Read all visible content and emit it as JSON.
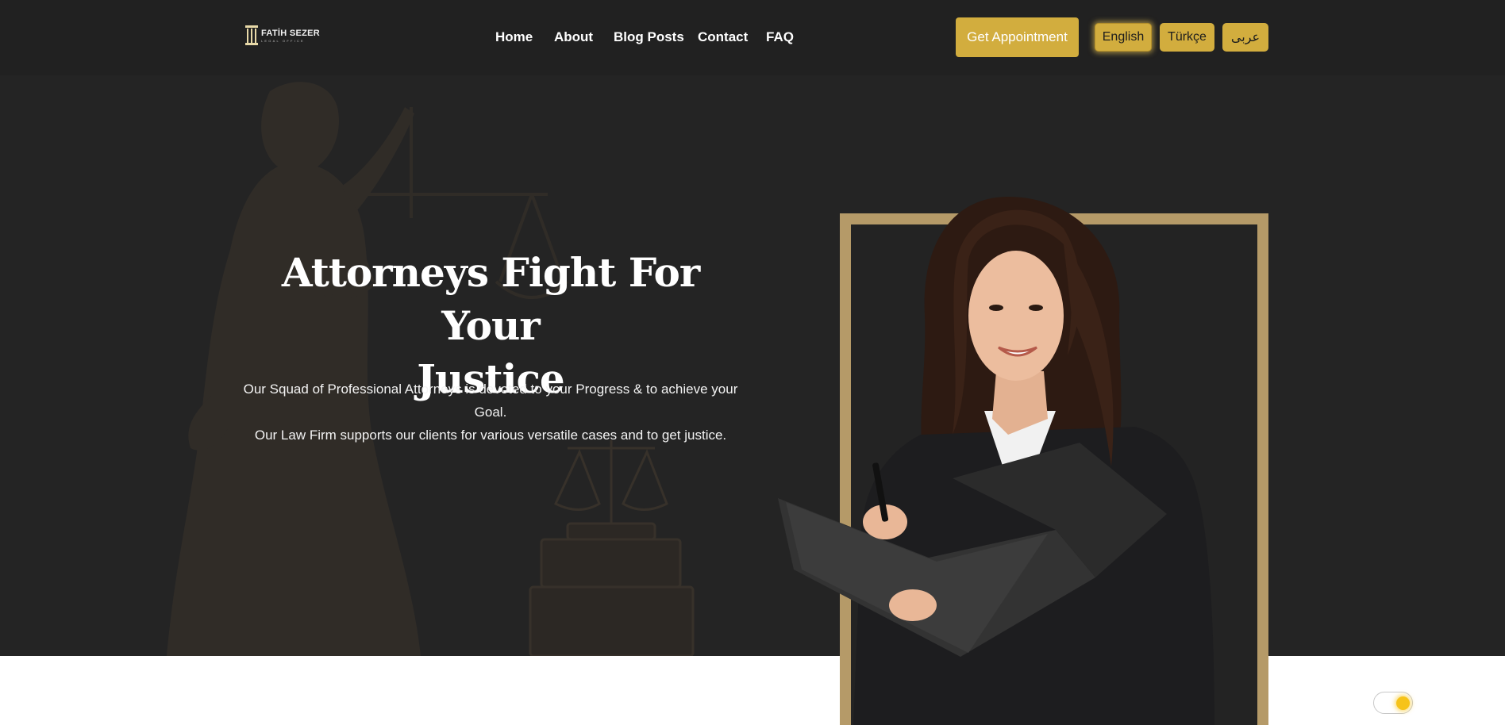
{
  "brand": {
    "name": "FATİH SEZER",
    "subtitle": "LEGAL OFFICE",
    "accent_color": "#d2ad3e",
    "frame_color": "#b59a68",
    "header_bg": "#212121",
    "hero_bg": "#242424"
  },
  "nav": {
    "items": [
      {
        "label": "Home"
      },
      {
        "label": "About"
      },
      {
        "label": "Blog Posts"
      },
      {
        "label": "Contact"
      },
      {
        "label": "FAQ"
      }
    ]
  },
  "header": {
    "cta_label": "Get Appointment",
    "languages": [
      {
        "label": "English",
        "active": true
      },
      {
        "label": "Türkçe",
        "active": false
      },
      {
        "label": "عربى",
        "active": false
      }
    ]
  },
  "hero": {
    "title_lines": [
      "Attorneys Fight For Your",
      "Justice"
    ],
    "description_lines": [
      "Our Squad of Professional Attorneys is devoted to your Progress & to achieve your Goal.",
      "Our Law Firm supports our clients for various versatile cases and to get justice."
    ],
    "background_image": "lady-justice-statue-and-scales",
    "portrait_image": "smiling-attorney-woman-holding-folder-and-pen"
  },
  "theme_toggle": {
    "icon": "sun-icon",
    "state": "light"
  }
}
